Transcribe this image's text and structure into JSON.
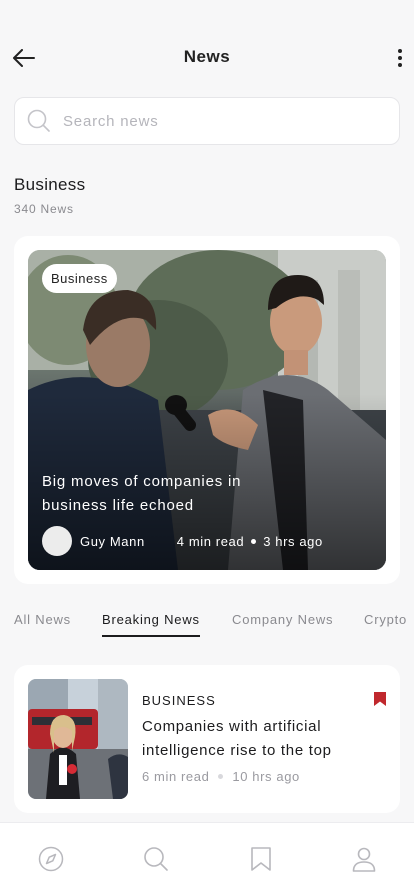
{
  "header": {
    "title": "News"
  },
  "search": {
    "placeholder": "Search news"
  },
  "section": {
    "title": "Business",
    "count": "340 News"
  },
  "featured": {
    "tag": "Business",
    "headline": "Big moves of companies in business life echoed",
    "author": "Guy Mann",
    "read_time": "4 min read",
    "time_ago": "3 hrs ago"
  },
  "tabs": [
    {
      "label": "All News",
      "active": false
    },
    {
      "label": "Breaking News",
      "active": true
    },
    {
      "label": "Company News",
      "active": false
    },
    {
      "label": "Crypto",
      "active": false
    }
  ],
  "news_items": [
    {
      "category": "BUSINESS",
      "headline": "Companies with artificial intelligence rise to the top",
      "read_time": "6 min read",
      "time_ago": "10 hrs ago",
      "bookmarked": true
    }
  ],
  "bottom_nav": {
    "items": [
      "compass-icon",
      "search-icon",
      "bookmark-icon",
      "profile-icon"
    ]
  },
  "colors": {
    "background": "#f7f7f8",
    "card": "#ffffff",
    "accent_bookmark": "#c0282d",
    "text_primary": "#1c1c1e",
    "text_secondary": "#8a8a8f"
  }
}
